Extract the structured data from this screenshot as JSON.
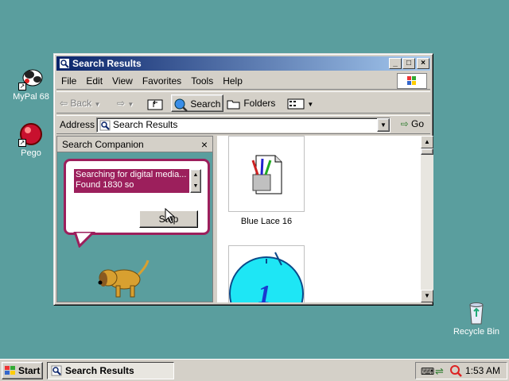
{
  "desktop": {
    "icons": [
      {
        "label": "MyPal 68",
        "icon": "mypal-icon"
      },
      {
        "label": "Pego",
        "icon": "pego-icon"
      },
      {
        "label": "Recycle Bin",
        "icon": "recycle-bin-icon"
      }
    ]
  },
  "window": {
    "title": "Search Results",
    "menu": [
      "File",
      "Edit",
      "View",
      "Favorites",
      "Tools",
      "Help"
    ],
    "toolbar": {
      "back_label": "Back",
      "search_label": "Search",
      "folders_label": "Folders"
    },
    "address": {
      "label": "Address",
      "value": "Search Results",
      "go_label": "Go"
    }
  },
  "companion": {
    "title": "Search Companion",
    "status_text": "Searching for digital media... Found 1830 so",
    "stop_label": "Stop"
  },
  "results": {
    "items": [
      {
        "label": "Blue Lace 16",
        "icon": "paint-file-icon"
      },
      {
        "label": "",
        "icon": "clock-thumbnail-icon"
      }
    ]
  },
  "taskbar": {
    "start_label": "Start",
    "task_label": "Search Results",
    "clock": "1:53 AM"
  },
  "colors": {
    "desktop": "#5a9e9e",
    "titlebar_start": "#0a246a",
    "titlebar_end": "#a6caf0",
    "bubble_border": "#9c1f5c"
  }
}
